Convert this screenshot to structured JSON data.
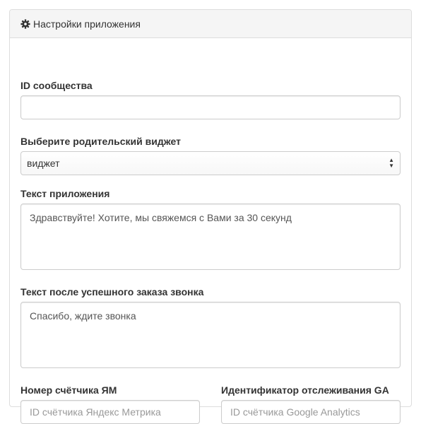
{
  "panel": {
    "title": "Настройки приложения",
    "icon": "gear-icon"
  },
  "form": {
    "community_id": {
      "label": "ID сообщества",
      "value": ""
    },
    "parent_widget": {
      "label": "Выберите родительский виджет",
      "selected": "виджет"
    },
    "app_text": {
      "label": "Текст приложения",
      "value": "Здравствуйте! Хотите, мы свяжемся с Вами за 30 секунд"
    },
    "after_order_text": {
      "label": "Текст после успешного заказа звонка",
      "value": "Спасибо, ждите звонка"
    },
    "ym_counter": {
      "label": "Номер счётчика ЯМ",
      "placeholder": "ID счётчика Яндекс Метрика"
    },
    "ga_tracking": {
      "label": "Идентификатор отслеживания GA",
      "placeholder": "ID счётчика Google Analytics"
    }
  }
}
